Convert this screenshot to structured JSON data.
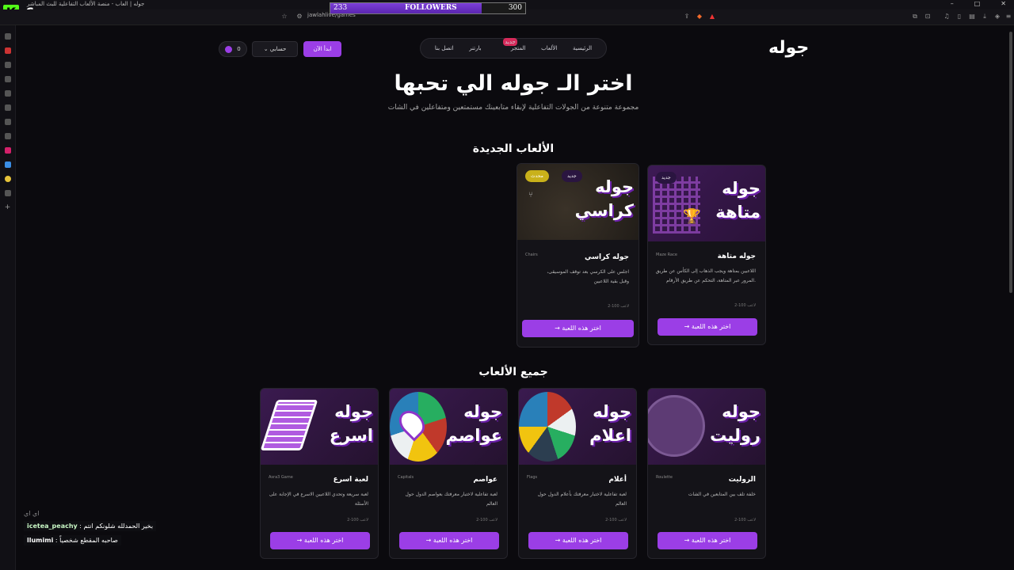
{
  "browser": {
    "window_title": "جوله | العاب - منصة الألعاب التفاعلية للبث المباشر",
    "url": "jawlahlive/games",
    "win_controls": [
      "–",
      "□",
      "✕"
    ],
    "overlay_badge": "6"
  },
  "followers_bar": {
    "current": "233",
    "label": "FOLLOWERS",
    "goal": "300",
    "progress": 0.777
  },
  "site": {
    "logo": "جوله",
    "nav": [
      "الرئيسية",
      "الألعاب",
      "المتجر",
      "بارتنر",
      "اتصل بنا"
    ],
    "nav_new_badge": "جديد",
    "start_btn": "ابدأ الآن",
    "account_btn": "حسابي",
    "coins": "0"
  },
  "hero": {
    "title": "اختر الـ جوله الي تحبها",
    "subtitle": "مجموعة متنوعة من الجولات التفاعلية لإبقاء متابعينك مستمتعين ومتفاعلين في الشات"
  },
  "sections": {
    "new_games": "الألعاب الجديدة",
    "all_games": "جميع الألعاب"
  },
  "new_games": [
    {
      "thumb_line1": "جوله",
      "thumb_line2": "متاهة",
      "title": "جوله متاهة",
      "en": "Maze Race",
      "desc": "اللاعبين بمتاهة ويجب الذهاب إلى الكأس عن طريق المرور عبر المتاهة، التحكم عن طريق الأرقام.",
      "meta": "2-100 لاعب",
      "badges": [
        "جديد"
      ],
      "button": "اختر هذه اللعبة"
    },
    {
      "thumb_line1": "جوله",
      "thumb_line2": "كراسي",
      "title": "جوله كراسي",
      "en": "Chairs",
      "desc": "اجلس على الكرسي بعد توقف الموسيقى، وقبل بقية اللاعبين",
      "meta": "2-100 لاعب",
      "badges": [
        "جديد",
        "محدث"
      ],
      "button": "اختر هذه اللعبة"
    }
  ],
  "all_games": [
    {
      "thumb_line1": "جوله",
      "thumb_line2": "روليت",
      "title": "الروليت",
      "en": "Roulette",
      "desc": "خلفة تلف بين المتابعين في الشات",
      "meta": "2-100 لاعب",
      "button": "اختر هذه اللعبة"
    },
    {
      "thumb_line1": "جوله",
      "thumb_line2": "اعلام",
      "title": "أعلام",
      "en": "Flags",
      "desc": "لعبة تفاعلية لاختبار معرفتك بأعلام الدول حول العالم",
      "meta": "2-100 لاعب",
      "button": "اختر هذه اللعبة"
    },
    {
      "thumb_line1": "جوله",
      "thumb_line2": "عواصم",
      "title": "عواصم",
      "en": "Capitals",
      "desc": "لعبة تفاعلية لاختبار معرفتك بعواصم الدول حول العالم",
      "meta": "2-100 لاعب",
      "button": "اختر هذه اللعبة"
    },
    {
      "thumb_line1": "جوله",
      "thumb_line2": "اسرع",
      "title": "لعبة اسرع",
      "en": "Asra3 Game",
      "desc": "لعبة سريعة وتحدي اللاعبين الاسرع في الإجابة على الأسئلة",
      "meta": "2-100 لاعب",
      "button": "اختر هذه اللعبة"
    }
  ],
  "chat": [
    {
      "user": "",
      "msg": "اي اي"
    },
    {
      "user": "icetea_peachy",
      "msg": "بخير الحمدلله شلونكم انتم"
    },
    {
      "user": "llumimi",
      "msg": "صاحبه المقطع شخصياً"
    }
  ],
  "colors": {
    "accent": "#9b3ee6",
    "background": "#0b0a0e",
    "card": "#141318",
    "badge_updated": "#c9b11a"
  }
}
